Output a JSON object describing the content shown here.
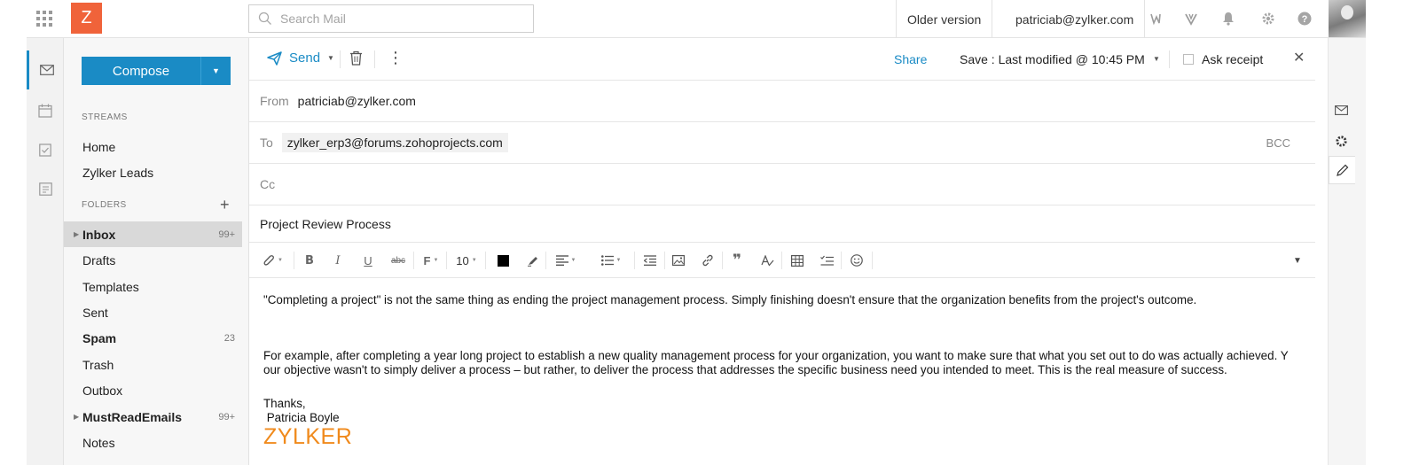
{
  "app": {
    "logo_letter": "Z",
    "brand_color": "#1a8bc5",
    "logo_color": "#f0633a"
  },
  "topbar": {
    "search_placeholder": "Search Mail",
    "older_version": "Older version",
    "account_email": "patriciab@zylker.com",
    "icons": [
      "apps-grid-icon",
      "search-icon",
      "cliq-icon",
      "streams-icon",
      "bell-icon",
      "gear-icon",
      "help-icon"
    ]
  },
  "rail": {
    "items": [
      "mail-icon",
      "calendar-icon",
      "tasks-icon",
      "notes-icon"
    ]
  },
  "sidebar": {
    "compose_label": "Compose",
    "streams_title": "STREAMS",
    "streams": [
      {
        "label": "Home"
      },
      {
        "label": "Zylker Leads"
      }
    ],
    "folders_title": "FOLDERS",
    "folders": [
      {
        "label": "Inbox",
        "count": "99+",
        "selected": true,
        "bold": true,
        "expandable": true
      },
      {
        "label": "Drafts",
        "count": ""
      },
      {
        "label": "Templates",
        "count": ""
      },
      {
        "label": "Sent",
        "count": ""
      },
      {
        "label": "Spam",
        "count": "23",
        "bold": true
      },
      {
        "label": "Trash",
        "count": ""
      },
      {
        "label": "Outbox",
        "count": ""
      },
      {
        "label": "MustReadEmails",
        "count": "99+",
        "bold": true,
        "expandable": true
      },
      {
        "label": "Notes",
        "count": ""
      }
    ]
  },
  "compose": {
    "send_label": "Send",
    "share_label": "Share",
    "save_status": "Save : Last modified @ 10:45 PM",
    "ask_receipt_label": "Ask receipt",
    "from_label": "From",
    "from_value": "patriciab@zylker.com",
    "to_label": "To",
    "to_value": "zylker_erp3@forums.zohoprojects.com",
    "bcc_label": "BCC",
    "cc_label": "Cc",
    "subject": "Project Review Process",
    "font_size": "10",
    "text_color": "#000000",
    "body": {
      "paragraph1": "\"Completing a project\" is not the same thing as ending the project management process. Simply finishing doesn't ensure that the organization benefits from the project's outcome.",
      "paragraph2a": "For example, after completing a year long project to establish a new quality management process for your organization, you want to make sure that what you set out to do was actually achieved. Y",
      "paragraph2b": "our objective wasn't to simply deliver a process – but rather, to deliver the process that addresses the specific business need you intended to meet. This is the real measure of success.",
      "signoff": "Thanks,",
      "signature_name": " Patricia Boyle",
      "signature_logo": "ZYLKER",
      "signature_logo_color": "#f08a1c"
    }
  },
  "right_rail": {
    "items": [
      "mail-icon",
      "gear-icon",
      "edit-icon"
    ]
  }
}
